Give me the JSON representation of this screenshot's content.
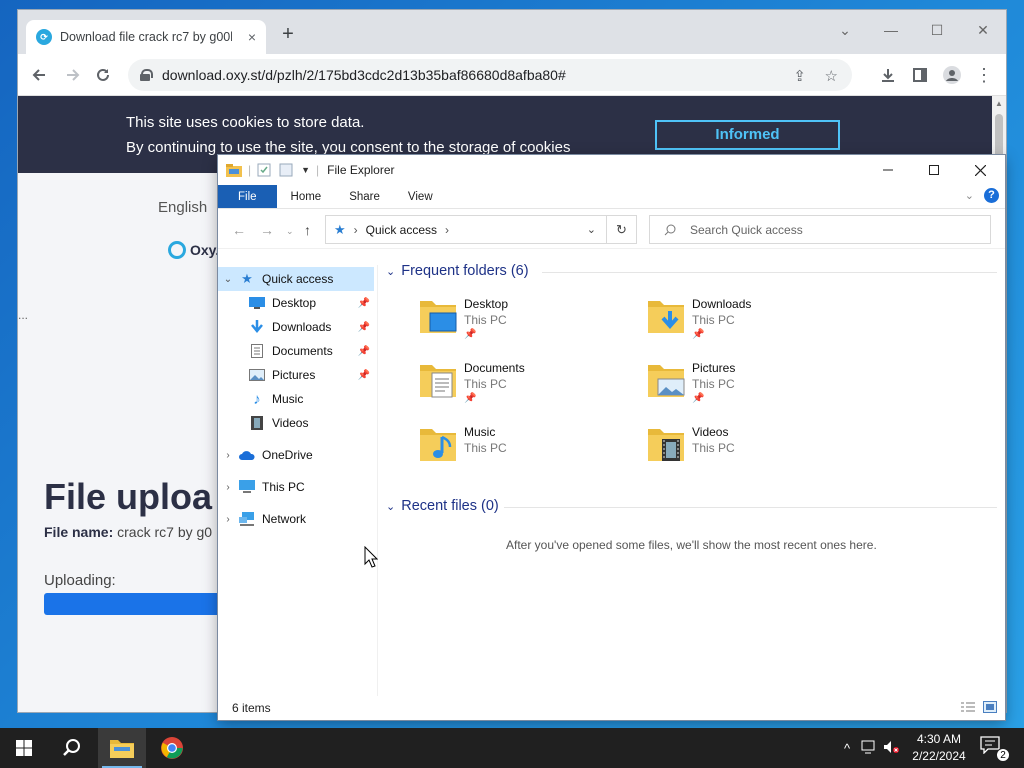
{
  "browser": {
    "tab_title": "Download file crack rc7 by g00bl",
    "tab_close": "×",
    "new_tab": "+",
    "url": "download.oxy.st/d/pzlh/2/175bd3cdc2d13b35baf86680d8afba80#",
    "controls": {
      "minimize": "—",
      "maximize": "☐",
      "close": "✕",
      "dropdown": "⌄"
    }
  },
  "page": {
    "cookie_line1": "This site uses cookies to store data.",
    "cookie_line2": "By continuing to use the site, you consent to the storage of cookies",
    "cookie_button": "Informed",
    "language": "English",
    "logo_text": "Oxy.",
    "upload_title": "File uploa",
    "file_name_label": "File name:",
    "file_name_value": "crack rc7 by g0",
    "uploading_label": "Uploading:",
    "side_dots": "..."
  },
  "explorer": {
    "title": "File Explorer",
    "ribbon_tabs": [
      "File",
      "Home",
      "Share",
      "View"
    ],
    "address_path": "Quick access",
    "search_placeholder": "Search Quick access",
    "nav": {
      "quick_access": "Quick access",
      "items": [
        {
          "label": "Desktop",
          "pinned": true
        },
        {
          "label": "Downloads",
          "pinned": true
        },
        {
          "label": "Documents",
          "pinned": true
        },
        {
          "label": "Pictures",
          "pinned": true
        },
        {
          "label": "Music",
          "pinned": false
        },
        {
          "label": "Videos",
          "pinned": false
        }
      ],
      "onedrive": "OneDrive",
      "this_pc": "This PC",
      "network": "Network"
    },
    "frequent_header": "Frequent folders (6)",
    "folders": [
      {
        "name": "Desktop",
        "location": "This PC",
        "pinned": true,
        "icon": "desktop-folder-icon"
      },
      {
        "name": "Downloads",
        "location": "This PC",
        "pinned": true,
        "icon": "downloads-folder-icon"
      },
      {
        "name": "Documents",
        "location": "This PC",
        "pinned": true,
        "icon": "documents-folder-icon"
      },
      {
        "name": "Pictures",
        "location": "This PC",
        "pinned": true,
        "icon": "pictures-folder-icon"
      },
      {
        "name": "Music",
        "location": "This PC",
        "pinned": false,
        "icon": "music-folder-icon"
      },
      {
        "name": "Videos",
        "location": "This PC",
        "pinned": false,
        "icon": "videos-folder-icon"
      }
    ],
    "recent_header": "Recent files (0)",
    "recent_empty": "After you've opened some files, we'll show the most recent ones here.",
    "status": "6 items"
  },
  "taskbar": {
    "time": "4:30 AM",
    "date": "2/22/2024",
    "notification_count": "2"
  },
  "colors": {
    "cookie_bg": "#2c3046",
    "accent_blue": "#1a73e8",
    "ribbon_file": "#1a5fb4",
    "nav_selected": "#cce8ff",
    "taskbar": "#202020"
  }
}
